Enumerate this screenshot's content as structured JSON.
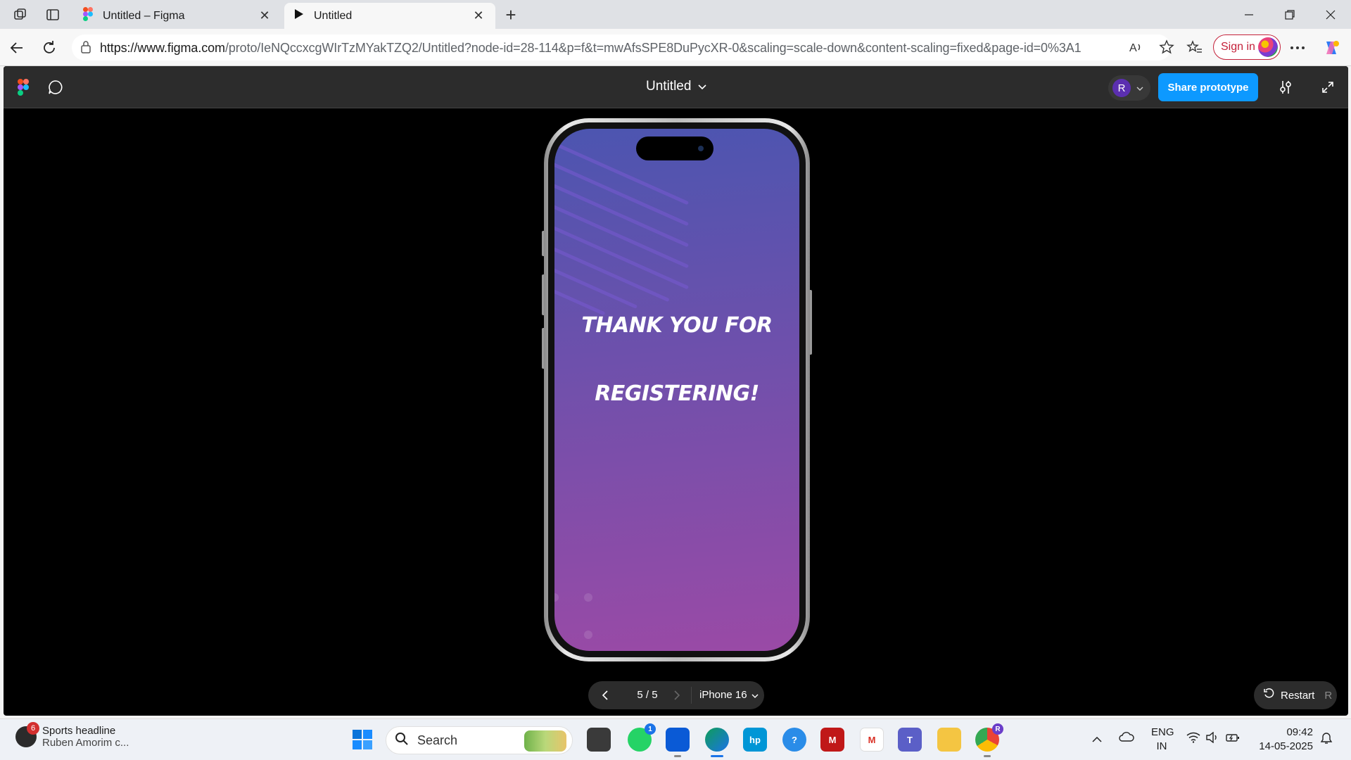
{
  "browser": {
    "tabs": [
      {
        "title": "Untitled – Figma",
        "active": false
      },
      {
        "title": "Untitled",
        "active": true
      }
    ],
    "url_host": "https://www.figma.com",
    "url_path": "/proto/IeNQccxcgWIrTzMYakTZQ2/Untitled?node-id=28-114&p=f&t=mwAfsSPE8DuPycXR-0&scaling=scale-down&content-scaling=fixed&page-id=0%3A1",
    "signin_label": "Sign in"
  },
  "figma": {
    "doc_title": "Untitled",
    "user_initial": "R",
    "share_label": "Share prototype",
    "pager": {
      "count": "5 / 5",
      "device": "iPhone 16"
    },
    "restart_label": "Restart",
    "restart_key": "R"
  },
  "screen": {
    "line1": "THANK YOU FOR",
    "line2": "REGISTERING!",
    "gradient_top": "#4c55b0",
    "gradient_bottom": "#9a4aa6"
  },
  "taskbar": {
    "news_badge": "6",
    "news_title": "Sports headline",
    "news_sub": "Ruben Amorim c...",
    "search_label": "Search",
    "whatsapp_badge": "1",
    "chrome_badge": "R",
    "lang_top": "ENG",
    "lang_bottom": "IN",
    "time": "09:42",
    "date": "14-05-2025"
  }
}
